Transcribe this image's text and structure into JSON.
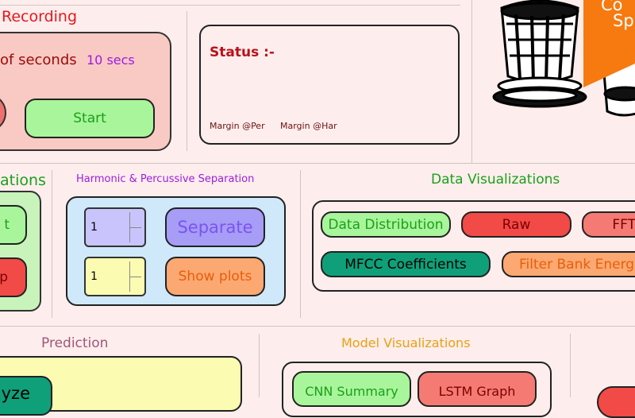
{
  "recording": {
    "title": "Recording",
    "seconds_label": "of seconds",
    "seconds_value": "10 secs",
    "start_label": "Start"
  },
  "status": {
    "title": "Status :-",
    "margin_per": "Margin @Per",
    "margin_har": "Margin @Har"
  },
  "analyze": {
    "title": "ations",
    "btn1": "t",
    "btn2": "p"
  },
  "hps": {
    "title": "Harmonic & Percussive Separation",
    "spin1_value": "1",
    "spin2_value": "1",
    "separate_label": "Separate",
    "show_plots_label": "Show plots"
  },
  "dataviz": {
    "title": "Data Visualizations",
    "data_distribution": "Data Distribution",
    "raw": "Raw",
    "fft": "FFT",
    "mfcc": "MFCC Coefficients",
    "filter_bank": "Filter Bank Energ"
  },
  "prediction": {
    "title": "Prediction",
    "analyze_label": "yze"
  },
  "modelviz": {
    "title": "Model Visualizations",
    "cnn_summary": "CNN Summary",
    "lstm_graph": "LSTM Graph"
  },
  "banner": {
    "line1": "Co",
    "line2": "Sp"
  },
  "colors": {
    "background": "#fdeeed",
    "recording_panel": "#f9c9c3",
    "green_button": "#a9f59b",
    "red_button": "#f24a47",
    "purple_button": "#a79cf6",
    "orange_button": "#fca872",
    "teal_button": "#0fa07a",
    "blue_panel": "#cfe9fb",
    "yellow_panel": "#fbfcb2",
    "orange_banner": "#f67a0f"
  }
}
